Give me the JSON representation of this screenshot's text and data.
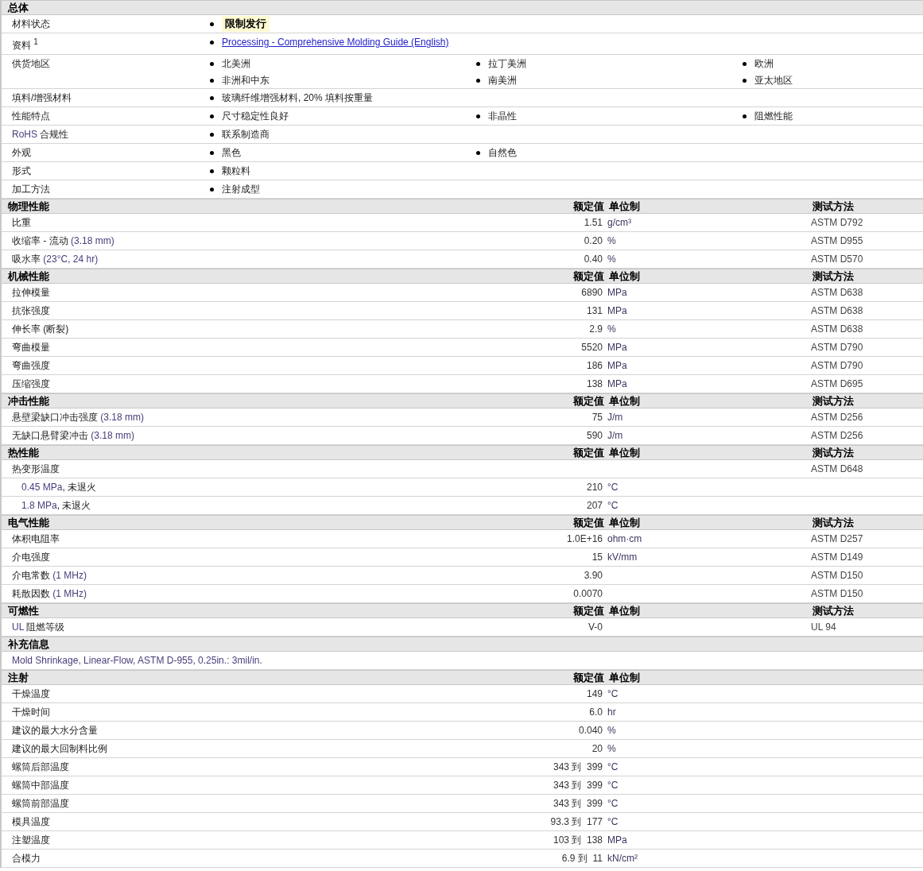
{
  "general": {
    "title": "总体",
    "rows": [
      {
        "label": [
          {
            "text": "材料状态",
            "term": false
          }
        ],
        "items": [
          {
            "text": "限制发行",
            "kind": "highlight"
          }
        ]
      },
      {
        "label": [
          {
            "text": "资料 $^{1}$",
            "term": false
          }
        ],
        "items": [
          {
            "text": "Processing - Comprehensive Molding Guide (English)",
            "kind": "link"
          }
        ]
      },
      {
        "label": [
          {
            "text": "供货地区",
            "term": false
          }
        ],
        "items": [
          {
            "text": "北美洲",
            "kind": "plain"
          },
          {
            "text": "拉丁美洲",
            "kind": "plain"
          },
          {
            "text": "欧洲",
            "kind": "plain"
          },
          {
            "text": "非洲和中东",
            "kind": "plain"
          },
          {
            "text": "南美洲",
            "kind": "plain"
          },
          {
            "text": "亚太地区",
            "kind": "plain"
          }
        ]
      },
      {
        "label": [
          {
            "text": "填料/增强材料",
            "term": false
          }
        ],
        "items": [
          {
            "text": "玻璃纤维增强材料, 20% 填料按重量",
            "kind": "plain"
          }
        ]
      },
      {
        "label": [
          {
            "text": "性能特点",
            "term": false
          }
        ],
        "items": [
          {
            "text": "尺寸稳定性良好",
            "kind": "plain"
          },
          {
            "text": "非晶性",
            "kind": "plain"
          },
          {
            "text": "阻燃性能",
            "kind": "plain"
          }
        ]
      },
      {
        "label": [
          {
            "text": "RoHS",
            "term": true
          },
          {
            "text": " 合规性",
            "term": false
          }
        ],
        "items": [
          {
            "text": "联系制造商",
            "kind": "plain"
          }
        ]
      },
      {
        "label": [
          {
            "text": "外观",
            "term": false
          }
        ],
        "items": [
          {
            "text": "黑色",
            "kind": "plain"
          },
          {
            "text": "自然色",
            "kind": "plain"
          }
        ]
      },
      {
        "label": [
          {
            "text": "形式",
            "term": false
          }
        ],
        "items": [
          {
            "text": "颗粒料",
            "kind": "plain"
          }
        ]
      },
      {
        "label": [
          {
            "text": "加工方法",
            "term": false
          }
        ],
        "items": [
          {
            "text": "注射成型",
            "kind": "plain"
          }
        ]
      }
    ]
  },
  "sections": [
    {
      "title": "物理性能",
      "columns": [
        "额定值",
        "单位制",
        "测试方法"
      ],
      "rows": [
        {
          "label": [
            {
              "text": "比重",
              "term": false
            }
          ],
          "value": "1.51",
          "unit": "g/cm³",
          "method": "ASTM D792"
        },
        {
          "label": [
            {
              "text": "收缩率 - 流动",
              "term": false
            },
            {
              "text": "(3.18 mm)",
              "term": true
            }
          ],
          "value": "0.20",
          "unit": "%",
          "method": "ASTM D955"
        },
        {
          "label": [
            {
              "text": "吸水率",
              "term": false
            },
            {
              "text": "(23°C, 24 hr)",
              "term": true
            }
          ],
          "value": "0.40",
          "unit": "%",
          "method": "ASTM D570"
        }
      ]
    },
    {
      "title": "机械性能",
      "columns": [
        "额定值",
        "单位制",
        "测试方法"
      ],
      "rows": [
        {
          "label": [
            {
              "text": "拉伸模量",
              "term": false
            }
          ],
          "value": "6890",
          "unit": "MPa",
          "method": "ASTM D638"
        },
        {
          "label": [
            {
              "text": "抗张强度",
              "term": false
            }
          ],
          "value": "131",
          "unit": "MPa",
          "method": "ASTM D638"
        },
        {
          "label": [
            {
              "text": "伸长率",
              "term": false
            },
            {
              "text": "(断裂)",
              "term": false
            }
          ],
          "value": "2.9",
          "unit": "%",
          "method": "ASTM D638"
        },
        {
          "label": [
            {
              "text": "弯曲模量",
              "term": false
            }
          ],
          "value": "5520",
          "unit": "MPa",
          "method": "ASTM D790"
        },
        {
          "label": [
            {
              "text": "弯曲强度",
              "term": false
            }
          ],
          "value": "186",
          "unit": "MPa",
          "method": "ASTM D790"
        },
        {
          "label": [
            {
              "text": "压缩强度",
              "term": false
            }
          ],
          "value": "138",
          "unit": "MPa",
          "method": "ASTM D695"
        }
      ]
    },
    {
      "title": "冲击性能",
      "columns": [
        "额定值",
        "单位制",
        "测试方法"
      ],
      "rows": [
        {
          "label": [
            {
              "text": "悬壁梁缺口冲击强度",
              "term": false
            },
            {
              "text": "(3.18 mm)",
              "term": true
            }
          ],
          "value": "75",
          "unit": "J/m",
          "method": "ASTM D256"
        },
        {
          "label": [
            {
              "text": "无缺口悬臂梁冲击",
              "term": false
            },
            {
              "text": "(3.18 mm)",
              "term": true
            }
          ],
          "value": "590",
          "unit": "J/m",
          "method": "ASTM D256"
        }
      ]
    },
    {
      "title": "热性能",
      "columns": [
        "额定值",
        "单位制",
        "测试方法"
      ],
      "rows": [
        {
          "label": [
            {
              "text": "热变形温度",
              "term": false
            }
          ],
          "method": "ASTM D648"
        },
        {
          "indent": true,
          "label": [
            {
              "text": "0.45 MPa",
              "term": true
            },
            {
              "text": ", 未退火",
              "term": false
            }
          ],
          "value": "210",
          "unit": "°C"
        },
        {
          "indent": true,
          "label": [
            {
              "text": "1.8 MPa",
              "term": true
            },
            {
              "text": ", 未退火",
              "term": false
            }
          ],
          "value": "207",
          "unit": "°C"
        }
      ]
    },
    {
      "title": "电气性能",
      "columns": [
        "额定值",
        "单位制",
        "测试方法"
      ],
      "rows": [
        {
          "label": [
            {
              "text": "体积电阻率",
              "term": false
            }
          ],
          "value": "1.0E+16",
          "unit": "ohm·cm",
          "method": "ASTM D257"
        },
        {
          "label": [
            {
              "text": "介电强度",
              "term": false
            }
          ],
          "value": "15",
          "unit": "kV/mm",
          "method": "ASTM D149"
        },
        {
          "label": [
            {
              "text": "介电常数",
              "term": false
            },
            {
              "text": "(1 MHz)",
              "term": true
            }
          ],
          "value": "3.90",
          "method": "ASTM D150"
        },
        {
          "label": [
            {
              "text": "耗散因数",
              "term": false
            },
            {
              "text": "(1 MHz)",
              "term": true
            }
          ],
          "value": "0.0070",
          "method": "ASTM D150"
        }
      ]
    },
    {
      "title": "可燃性",
      "columns": [
        "额定值",
        "单位制",
        "测试方法"
      ],
      "rows": [
        {
          "label": [
            {
              "text": "UL",
              "term": true
            },
            {
              "text": " 阻燃等级",
              "term": false
            }
          ],
          "value": "V-0",
          "method": "UL 94"
        }
      ]
    },
    {
      "title": "补充信息",
      "rows": [
        {
          "wide": true,
          "label": [
            {
              "text": "Mold Shrinkage, Linear-Flow, ASTM D-955, 0.25in.: 3mil/in.",
              "term": true
            }
          ]
        }
      ]
    },
    {
      "title": "注射",
      "columns": [
        "额定值",
        "单位制"
      ],
      "rows": [
        {
          "label": [
            {
              "text": "干燥温度",
              "term": false
            }
          ],
          "value": "149",
          "unit": "°C"
        },
        {
          "label": [
            {
              "text": "干燥时间",
              "term": false
            }
          ],
          "value": "6.0",
          "unit": "hr"
        },
        {
          "label": [
            {
              "text": "建议的最大水分含量",
              "term": false
            }
          ],
          "value": "0.040",
          "unit": "%"
        },
        {
          "label": [
            {
              "text": "建议的最大回制料比例",
              "term": false
            }
          ],
          "value": "20",
          "unit": "%"
        },
        {
          "label": [
            {
              "text": "螺筒后部温度",
              "term": false
            }
          ],
          "value": "343 到  399",
          "unit": "°C"
        },
        {
          "label": [
            {
              "text": "螺筒中部温度",
              "term": false
            }
          ],
          "value": "343 到  399",
          "unit": "°C"
        },
        {
          "label": [
            {
              "text": "螺筒前部温度",
              "term": false
            }
          ],
          "value": "343 到  399",
          "unit": "°C"
        },
        {
          "label": [
            {
              "text": "模具温度",
              "term": false
            }
          ],
          "value": "93.3 到  177",
          "unit": "°C"
        },
        {
          "label": [
            {
              "text": "注塑温度",
              "term": false
            }
          ],
          "value": "103 到  138",
          "unit": "MPa"
        },
        {
          "label": [
            {
              "text": "合模力",
              "term": false
            }
          ],
          "value": "6.9 到  11",
          "unit": "kN/cm²"
        }
      ]
    }
  ]
}
